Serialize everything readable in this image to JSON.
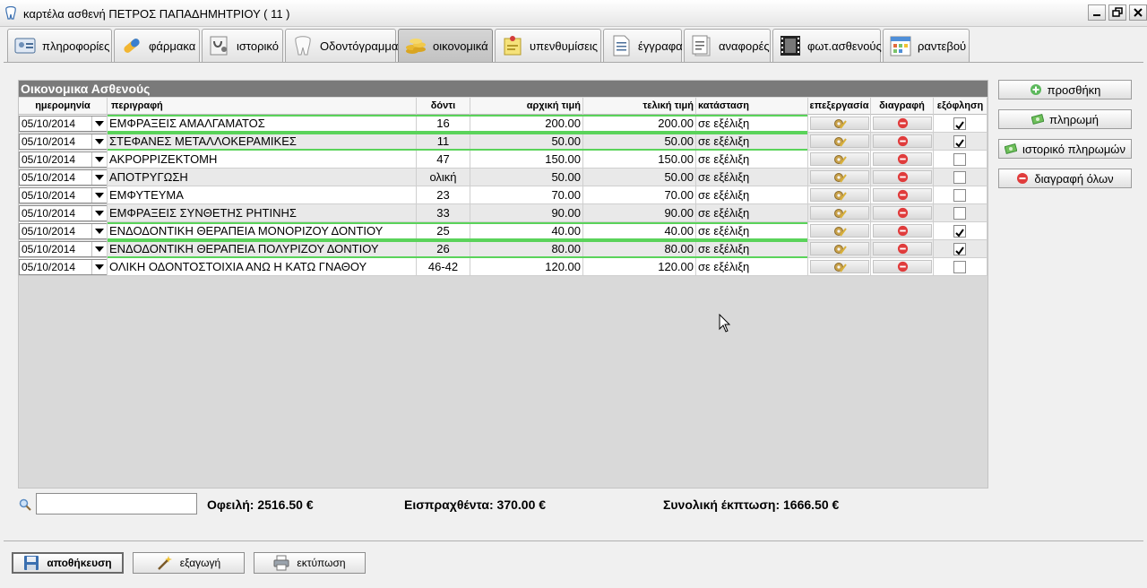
{
  "window": {
    "title": "καρτέλα ασθενή ΠΕΤΡΟΣ ΠΑΠΑΔΗΜΗΤΡΙΟΥ ( 11 )"
  },
  "tabs": [
    {
      "label": "πληροφορίες",
      "icon": "id-card-icon"
    },
    {
      "label": "φάρμακα",
      "icon": "pill-icon"
    },
    {
      "label": "ιστορικό",
      "icon": "stethoscope-icon"
    },
    {
      "label": "Οδοντόγραμμα",
      "icon": "tooth-icon"
    },
    {
      "label": "οικονομικά",
      "icon": "coins-icon",
      "active": true
    },
    {
      "label": "υπενθυμίσεις",
      "icon": "note-pin-icon"
    },
    {
      "label": "έγγραφα",
      "icon": "document-icon"
    },
    {
      "label": "αναφορές",
      "icon": "report-icon"
    },
    {
      "label": "φωτ.ασθενούς",
      "icon": "film-icon"
    },
    {
      "label": "ραντεβού",
      "icon": "calendar-icon"
    }
  ],
  "grid": {
    "title": "Οικονομικα Ασθενούς",
    "headers": {
      "date": "ημερομηνία",
      "description": "περιγραφή",
      "tooth": "δόντι",
      "initial_price": "αρχική τιμή",
      "final_price": "τελική τιμή",
      "status": "κατάσταση",
      "edit": "επεξεργασία",
      "delete": "διαγραφή",
      "paid": "εξόφληση"
    },
    "rows": [
      {
        "date": "05/10/2014",
        "description": "ΕΜΦΡΑΞΕΙΣ ΑΜΑΛΓΑΜΑΤΟΣ",
        "tooth": "16",
        "initial_price": "200.00",
        "final_price": "200.00",
        "status": "σε εξέλιξη",
        "paid": true
      },
      {
        "date": "05/10/2014",
        "description": "ΣΤΕΦΑΝΕΣ ΜΕΤΑΛΛΟΚΕΡΑΜΙΚΕΣ",
        "tooth": "11",
        "initial_price": "50.00",
        "final_price": "50.00",
        "status": "σε εξέλιξη",
        "paid": true
      },
      {
        "date": "05/10/2014",
        "description": "ΑΚΡΟΡΡΙΖΕΚΤΟΜΗ",
        "tooth": "47",
        "initial_price": "150.00",
        "final_price": "150.00",
        "status": "σε εξέλιξη",
        "paid": false
      },
      {
        "date": "05/10/2014",
        "description": "ΑΠΟΤΡΥΓΩΣΗ",
        "tooth": "ολική",
        "initial_price": "50.00",
        "final_price": "50.00",
        "status": "σε εξέλιξη",
        "paid": false
      },
      {
        "date": "05/10/2014",
        "description": "ΕΜΦΥΤΕΥΜΑ",
        "tooth": "23",
        "initial_price": "70.00",
        "final_price": "70.00",
        "status": "σε εξέλιξη",
        "paid": false
      },
      {
        "date": "05/10/2014",
        "description": "ΕΜΦΡΑΞΕΙΣ ΣΥΝΘΕΤΗΣ ΡΗΤΙΝΗΣ",
        "tooth": "33",
        "initial_price": "90.00",
        "final_price": "90.00",
        "status": "σε εξέλιξη",
        "paid": false
      },
      {
        "date": "05/10/2014",
        "description": "ΕΝΔΟΔΟΝΤΙΚΗ ΘΕΡΑΠΕΙΑ ΜΟΝΟΡΙΖΟΥ ΔΟΝΤΙΟΥ",
        "tooth": "25",
        "initial_price": "40.00",
        "final_price": "40.00",
        "status": "σε εξέλιξη",
        "paid": true
      },
      {
        "date": "05/10/2014",
        "description": "ΕΝΔΟΔΟΝΤΙΚΗ ΘΕΡΑΠΕΙΑ ΠΟΛΥΡΙΖΟΥ ΔΟΝΤΙΟΥ",
        "tooth": "26",
        "initial_price": "80.00",
        "final_price": "80.00",
        "status": "σε εξέλιξη",
        "paid": true
      },
      {
        "date": "05/10/2014",
        "description": "ΟΛΙΚΗ ΟΔΟΝΤΟΣΤΟΙΧΙΑ ΑΝΩ Η ΚΑΤΩ ΓΝΑΘΟΥ",
        "tooth": "46-42",
        "initial_price": "120.00",
        "final_price": "120.00",
        "status": "σε εξέλιξη",
        "paid": false
      }
    ]
  },
  "side_buttons": {
    "add": "προσθήκη",
    "payment": "πληρωμή",
    "payment_history": "ιστορικό πληρωμών",
    "delete_all": "διαγραφή όλων"
  },
  "summary": {
    "search_value": "",
    "owed": "Οφειλή: 2516.50 €",
    "collected": "Εισπραχθέντα: 370.00 €",
    "discount": "Συνολική έκπτωση: 1666.50 €"
  },
  "footer": {
    "save": "αποθήκευση",
    "export": "εξαγωγή",
    "print": "εκτύπωση"
  },
  "colors": {
    "paid_line": "#5ad35a",
    "grid_title_bg": "#7a7a7a",
    "delete_red": "#e03c3c"
  }
}
